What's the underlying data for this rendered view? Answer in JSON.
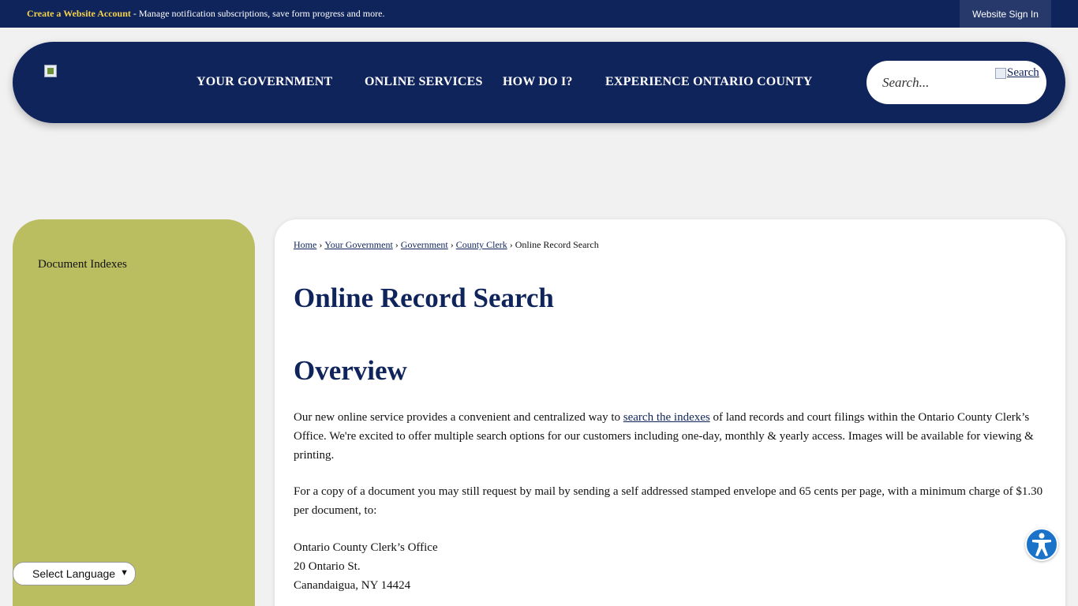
{
  "topbar": {
    "create_link": "Create a Website Account",
    "message": " - Manage notification subscriptions, save form progress and more.",
    "sign_in": "Website Sign In"
  },
  "nav": {
    "items": [
      "YOUR GOVERNMENT",
      "ONLINE SERVICES",
      "HOW DO I?",
      "EXPERIENCE ONTARIO COUNTY"
    ],
    "search_placeholder": "Search...",
    "search_button": "Search"
  },
  "sidebar": {
    "items": [
      "Document Indexes"
    ]
  },
  "breadcrumb": {
    "links": [
      "Home",
      "Your Government",
      "Government",
      "County Clerk"
    ],
    "current": "Online Record Search",
    "separator": "›"
  },
  "page": {
    "title": "Online Record Search",
    "section_title": "Overview",
    "p1_before": "Our new online service provides a convenient and centralized way to ",
    "p1_link": "search the indexes",
    "p1_after": " of land records and court filings within the Ontario County Clerk’s Office. We're excited to offer multiple search options for our customers including one-day, monthly & yearly access. Images will be available for viewing & printing.",
    "p2": "For a copy of a document you may still request by mail by sending a self addressed stamped envelope and 65 cents per page, with a minimum charge of $1.30 per document, to:",
    "address": [
      "Ontario County Clerk’s Office",
      "20 Ontario St.",
      "Canandaigua, NY 14424"
    ]
  },
  "language_select": {
    "selected": "Select Language"
  },
  "colors": {
    "navy": "#10245c",
    "sidebar": "#bbbe60",
    "accent_yellow": "#f4d24a",
    "a11y_blue": "#1a73c8"
  },
  "icons": [
    "logo-image",
    "search-image",
    "accessibility-icon",
    "chevron-down-icon"
  ]
}
